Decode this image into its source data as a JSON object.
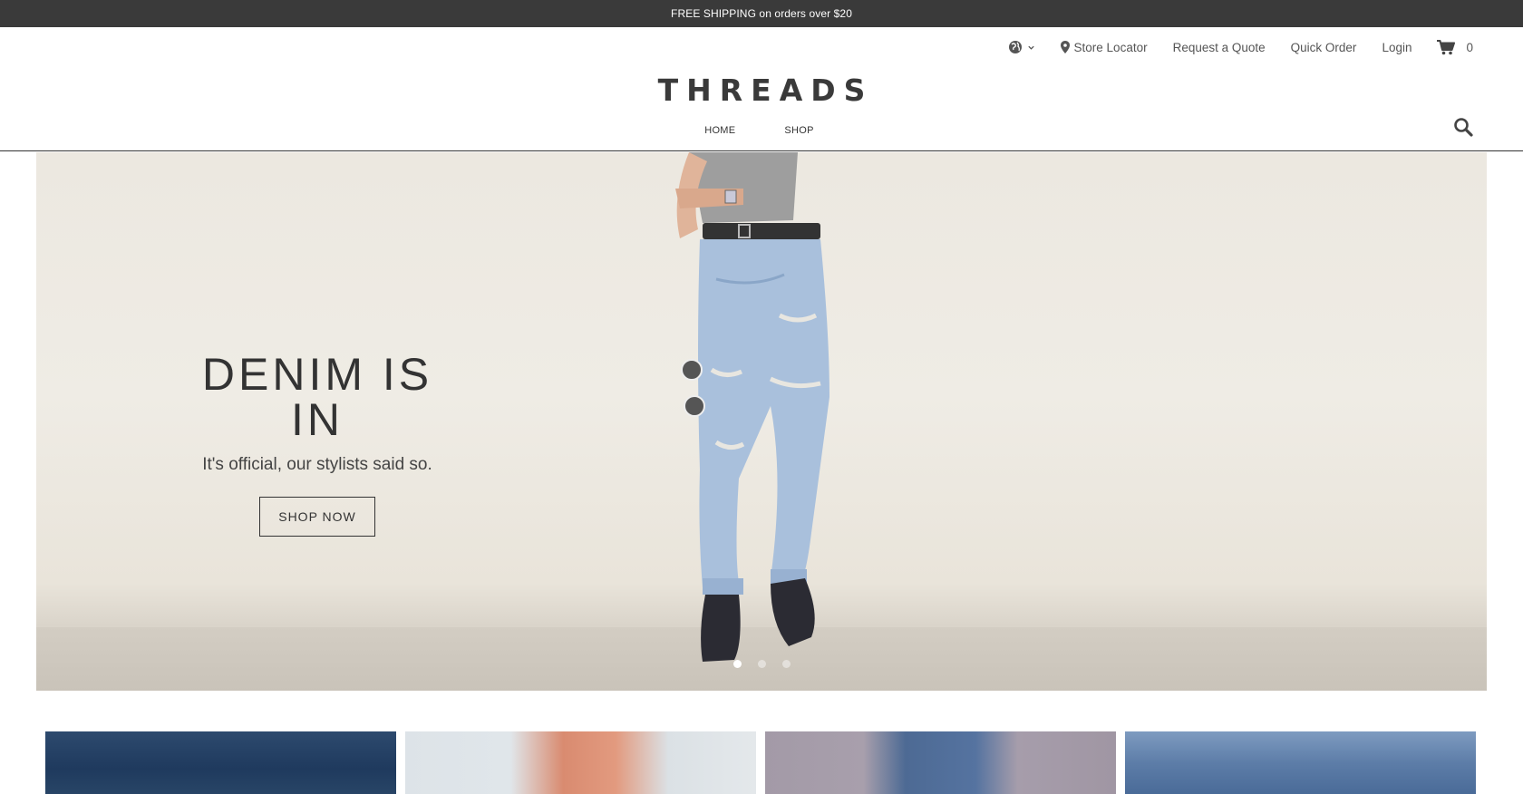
{
  "promo": {
    "text": "FREE SHIPPING on orders over $20"
  },
  "utility_nav": {
    "store_locator": "Store Locator",
    "request_quote": "Request a Quote",
    "quick_order": "Quick Order",
    "login": "Login",
    "cart_count": "0"
  },
  "logo": {
    "text": "THREADS"
  },
  "main_nav": {
    "items": [
      "HOME",
      "SHOP"
    ]
  },
  "hero": {
    "title": "DENIM IS IN",
    "subtitle": "It's official, our stylists said so.",
    "button_label": "SHOP NOW",
    "slide_count": 3,
    "active_slide": 1
  },
  "colors": {
    "promo_bg": "#3a3a3a",
    "text_dark": "#333333",
    "hero_bg": "#ece8e0"
  },
  "icons": [
    "globe-icon",
    "chevron-down-icon",
    "map-pin-icon",
    "cart-icon",
    "search-icon"
  ]
}
